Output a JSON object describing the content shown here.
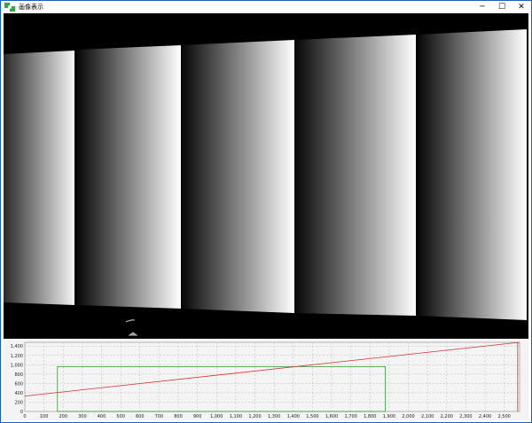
{
  "window": {
    "title": "画像表示",
    "icon": "green-puzzle-icon",
    "controls": {
      "minimize": "─",
      "maximize": "☐",
      "close": "✕"
    }
  },
  "image_view": {
    "description_colors": {
      "background": "#000000",
      "stripe_dark": "#050505",
      "stripe_light": "#ffffff"
    },
    "stripe_count": 5
  },
  "chart_data": {
    "type": "line",
    "x_ticks": [
      0,
      100,
      200,
      300,
      400,
      500,
      600,
      700,
      800,
      900,
      1000,
      1100,
      1200,
      1300,
      1400,
      1500,
      1600,
      1700,
      1800,
      1900,
      2000,
      2100,
      2200,
      2300,
      2400,
      2500
    ],
    "x_tick_labels": [
      "0",
      "100",
      "200",
      "300",
      "400",
      "500",
      "600",
      "700",
      "800",
      "900",
      "1,000",
      "1,100",
      "1,200",
      "1,300",
      "1,400",
      "1,500",
      "1,600",
      "1,700",
      "1,800",
      "1,900",
      "2,000",
      "2,100",
      "2,200",
      "2,300",
      "2,400",
      "2,500"
    ],
    "y_ticks": [
      0,
      200,
      400,
      600,
      800,
      1000,
      1200,
      1400
    ],
    "y_tick_labels": [
      "0",
      "200",
      "400",
      "600",
      "800",
      "1,000",
      "1,200",
      "1,400"
    ],
    "xlim": [
      0,
      2580
    ],
    "ylim": [
      0,
      1480
    ],
    "grid": true,
    "series": [
      {
        "color": "#d03030",
        "x": [
          0,
          2580
        ],
        "y": [
          330,
          1500
        ]
      }
    ],
    "roi_box": {
      "color": "#3a9a3a",
      "x": [
        170,
        1880
      ],
      "y": [
        0,
        960
      ]
    },
    "right_marker": {
      "color": "#d03030",
      "x": 2570
    }
  }
}
